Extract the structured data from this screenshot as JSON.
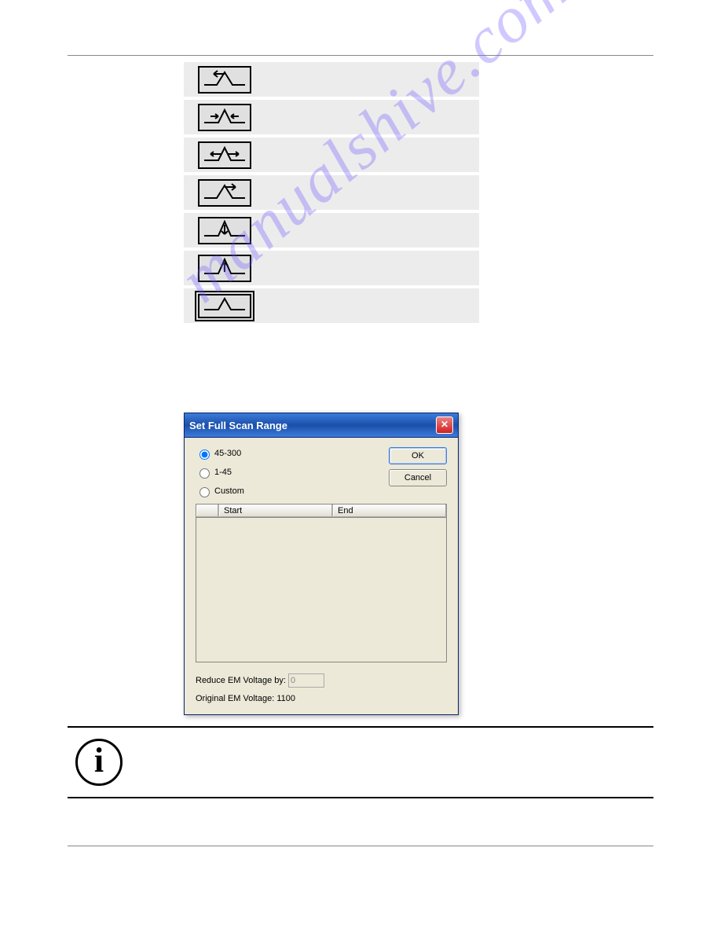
{
  "watermark": "manualshive.com",
  "toolbar_icons": [
    {
      "name": "peak-shift-left-icon"
    },
    {
      "name": "peak-narrow-icon"
    },
    {
      "name": "peak-widen-icon"
    },
    {
      "name": "peak-shift-right-icon"
    },
    {
      "name": "peak-height-down-icon"
    },
    {
      "name": "peak-height-up-icon"
    },
    {
      "name": "peak-full-view-icon"
    }
  ],
  "dialog": {
    "title": "Set Full Scan Range",
    "options": {
      "opt1": "45-300",
      "opt2": "1-45",
      "opt3": "Custom"
    },
    "selected": "opt1",
    "buttons": {
      "ok": "OK",
      "cancel": "Cancel"
    },
    "columns": {
      "start": "Start",
      "end": "End"
    },
    "reduce_label": "Reduce EM Voltage by:",
    "reduce_value": "0",
    "orig_label": "Original EM Voltage:  1100"
  },
  "info_glyph": "i"
}
